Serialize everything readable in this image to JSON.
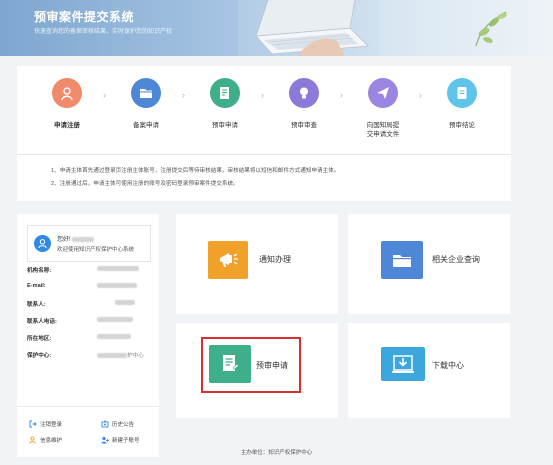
{
  "banner": {
    "title": "预审案件提交系统",
    "subtitle": "快速查询您的备案审核结果，实时保护您的知识产权"
  },
  "steps": [
    {
      "label": "申请注册",
      "icon": "user-register-icon",
      "color": "#ef8a6a",
      "bold": true
    },
    {
      "label": "备案申请",
      "icon": "folder-icon",
      "color": "#4d87d6",
      "bold": false
    },
    {
      "label": "预审申请",
      "icon": "document-icon",
      "color": "#3fae8a",
      "bold": false
    },
    {
      "label": "预审审查",
      "icon": "lightbulb-icon",
      "color": "#8c7ad8",
      "bold": false
    },
    {
      "label": "向国知局提\n交申请文件",
      "icon": "paper-plane-icon",
      "color": "#9a86e0",
      "bold": false
    },
    {
      "label": "预审结论",
      "icon": "file-icon",
      "color": "#5fc3ea",
      "bold": false
    }
  ],
  "notes": [
    "1、申请主体首先通过登录页注册主体账号，注册提交后等待审核结果，审核结果将以短信和邮件方式通知申请主体。",
    "2、注册通过后，申请主体可使用注册的账号及密码登录预审案件提交系统。"
  ],
  "profile": {
    "greeting": "您好!",
    "welcome": "欢迎使用知识产权保护中心系统",
    "fields": [
      {
        "label": "机构名称:"
      },
      {
        "label": "E-mail:"
      },
      {
        "label": "联系人:"
      },
      {
        "label": "联系人电话:"
      },
      {
        "label": "所在地区:"
      },
      {
        "label": "保护中心:",
        "value_suffix": "护中心"
      }
    ],
    "links": [
      {
        "label": "注销登录",
        "icon": "logout-icon"
      },
      {
        "label": "历史公告",
        "icon": "announcement-icon"
      },
      {
        "label": "信息维护",
        "icon": "user-info-icon"
      },
      {
        "label": "新建子账号",
        "icon": "add-subaccount-icon"
      }
    ]
  },
  "tiles": [
    {
      "label": "通知办理",
      "icon": "megaphone-icon",
      "color": "#f0a12a"
    },
    {
      "label": "相关企业查询",
      "icon": "folder-icon",
      "color": "#4d87d6"
    },
    {
      "label": "预审申请",
      "icon": "document-icon",
      "color": "#3fae8a"
    },
    {
      "label": "下载中心",
      "icon": "download-icon",
      "color": "#3ba7dd"
    }
  ],
  "footer": "主办单位：知识产权保护中心",
  "colors": {
    "highlight": "#d8302c",
    "link_icon": "#2f8ae6",
    "link_icon_alt": "#f0a12a"
  }
}
